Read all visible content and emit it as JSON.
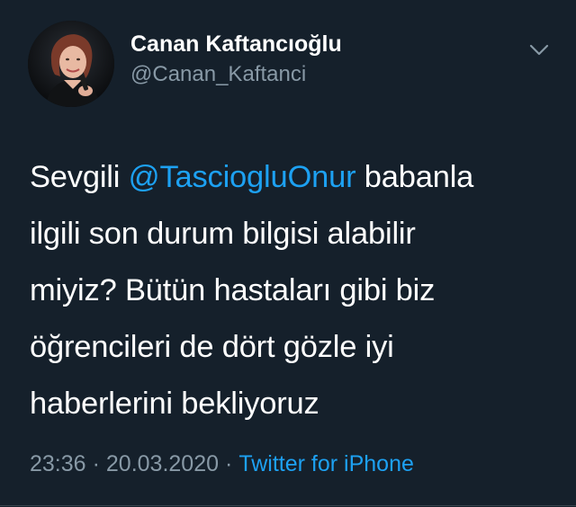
{
  "author": {
    "display_name": "Canan Kaftancıoğlu",
    "handle": "@Canan_Kaftanci"
  },
  "tweet": {
    "line1_prefix": "Sevgili ",
    "mention": "@TasciogluOnur",
    "line1_suffix": " babanla",
    "line2": "ilgili son durum bilgisi alabilir",
    "line3": "miyiz? Bütün hastaları gibi biz",
    "line4": "öğrencileri de dört gözle iyi",
    "line5": "haberlerini bekliyoruz"
  },
  "meta": {
    "time": "23:36",
    "separator": "·",
    "date": "20.03.2020",
    "source": "Twitter for iPhone"
  },
  "icons": {
    "more": "chevron-down-icon",
    "avatar": "profile-photo"
  },
  "colors": {
    "background": "#15202b",
    "text": "#ffffff",
    "secondary_text": "#8899a6",
    "accent": "#1da1f2"
  }
}
